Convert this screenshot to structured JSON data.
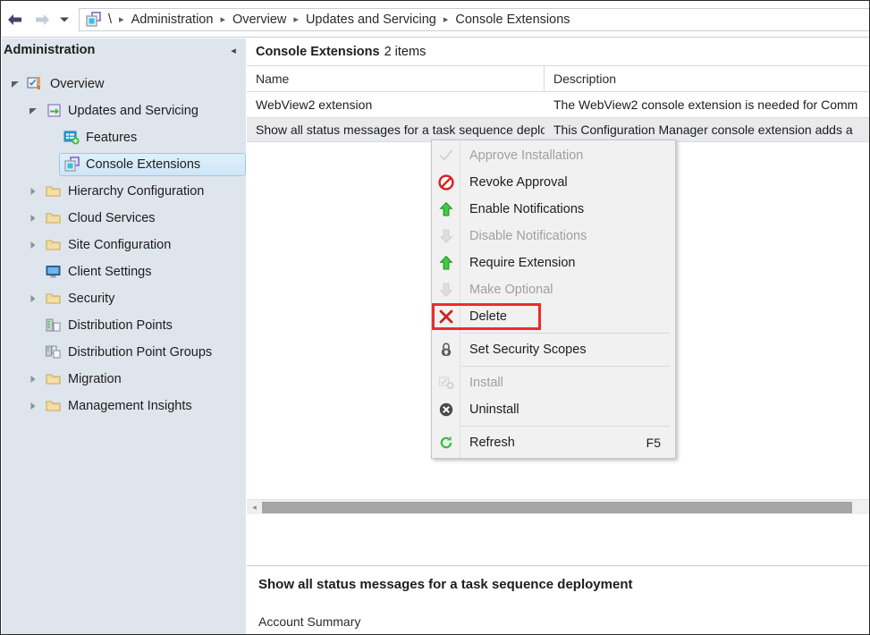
{
  "breadcrumb": {
    "back_label": "Back",
    "forward_label": "Forward",
    "history_label": "Recent locations",
    "root": "\\",
    "items": [
      "Administration",
      "Overview",
      "Updates and Servicing",
      "Console Extensions"
    ],
    "separator": "▸"
  },
  "sidebar": {
    "title": "Administration",
    "collapse_label": "◂",
    "items": [
      {
        "label": "Overview",
        "icon": "overview-icon",
        "depth": 0,
        "twisty": "expanded",
        "selected": false
      },
      {
        "label": "Updates and Servicing",
        "icon": "updates-icon",
        "depth": 1,
        "twisty": "expanded",
        "selected": false
      },
      {
        "label": "Features",
        "icon": "features-icon",
        "depth": 2,
        "twisty": "none",
        "selected": false
      },
      {
        "label": "Console Extensions",
        "icon": "console-extensions-icon",
        "depth": 2,
        "twisty": "none",
        "selected": true
      },
      {
        "label": "Hierarchy Configuration",
        "icon": "folder-icon",
        "depth": 1,
        "twisty": "collapsed",
        "selected": false
      },
      {
        "label": "Cloud Services",
        "icon": "folder-icon",
        "depth": 1,
        "twisty": "collapsed",
        "selected": false
      },
      {
        "label": "Site Configuration",
        "icon": "folder-icon",
        "depth": 1,
        "twisty": "collapsed",
        "selected": false
      },
      {
        "label": "Client Settings",
        "icon": "client-settings-icon",
        "depth": 1,
        "twisty": "none",
        "selected": false
      },
      {
        "label": "Security",
        "icon": "folder-icon",
        "depth": 1,
        "twisty": "collapsed",
        "selected": false
      },
      {
        "label": "Distribution Points",
        "icon": "distribution-point-icon",
        "depth": 1,
        "twisty": "none",
        "selected": false
      },
      {
        "label": "Distribution Point Groups",
        "icon": "distribution-point-group-icon",
        "depth": 1,
        "twisty": "none",
        "selected": false
      },
      {
        "label": "Migration",
        "icon": "folder-icon",
        "depth": 1,
        "twisty": "collapsed",
        "selected": false
      },
      {
        "label": "Management Insights",
        "icon": "folder-icon",
        "depth": 1,
        "twisty": "collapsed",
        "selected": false
      }
    ]
  },
  "list": {
    "title": "Console Extensions",
    "count_text": "2 items",
    "columns": [
      "Name",
      "Description"
    ],
    "rows": [
      {
        "name": "WebView2 extension",
        "description": "The WebView2 console extension is needed for Comm",
        "selected": false
      },
      {
        "name": "Show all status messages for a task sequence deployment",
        "description": "This Configuration Manager console extension adds a",
        "selected": true
      }
    ],
    "scrollbar": {
      "left_arrow": "◂",
      "right_arrow": "▸"
    }
  },
  "context_menu": {
    "items": [
      {
        "label": "Approve Installation",
        "icon": "check-icon",
        "disabled": true,
        "shortcut": "",
        "separator_after": false
      },
      {
        "label": "Revoke Approval",
        "icon": "no-entry-icon",
        "disabled": false,
        "shortcut": "",
        "separator_after": false
      },
      {
        "label": "Enable Notifications",
        "icon": "green-up-arrow-icon",
        "disabled": false,
        "shortcut": "",
        "separator_after": false
      },
      {
        "label": "Disable Notifications",
        "icon": "gray-down-arrow-icon",
        "disabled": true,
        "shortcut": "",
        "separator_after": false
      },
      {
        "label": "Require Extension",
        "icon": "green-up-arrow-icon",
        "disabled": false,
        "shortcut": "",
        "separator_after": false
      },
      {
        "label": "Make Optional",
        "icon": "gray-down-arrow-icon",
        "disabled": true,
        "shortcut": "",
        "separator_after": false
      },
      {
        "label": "Delete",
        "icon": "red-x-icon",
        "disabled": false,
        "shortcut": "",
        "separator_after": true,
        "highlighted": true
      },
      {
        "label": "Set Security Scopes",
        "icon": "padlock-icon",
        "disabled": false,
        "shortcut": "",
        "separator_after": true
      },
      {
        "label": "Install",
        "icon": "install-icon",
        "disabled": true,
        "shortcut": "",
        "separator_after": false
      },
      {
        "label": "Uninstall",
        "icon": "uninstall-x-circle-icon",
        "disabled": false,
        "shortcut": "",
        "separator_after": true
      },
      {
        "label": "Refresh",
        "icon": "refresh-icon",
        "disabled": false,
        "shortcut": "F5",
        "separator_after": false
      }
    ],
    "highlight_color": "#ee2b2b"
  },
  "detail": {
    "title": "Show all status messages for a task sequence deployment",
    "subtitle": "Account Summary"
  }
}
